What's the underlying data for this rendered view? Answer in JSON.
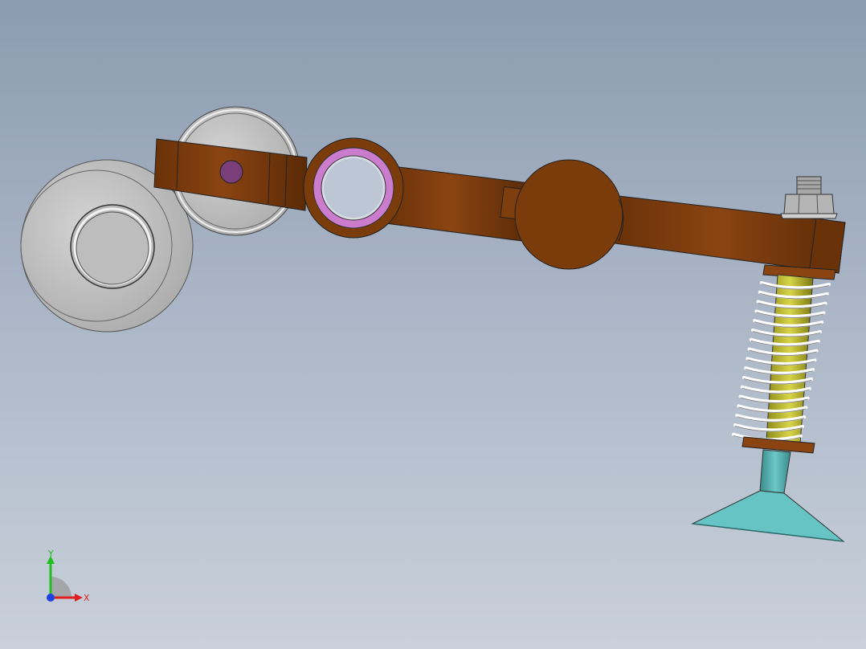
{
  "viewport": {
    "background_top": "#8c9bb0",
    "background_bottom": "#c9d0da"
  },
  "model": {
    "colors": {
      "arm": "#7a3c0a",
      "arm_dark": "#5e2d07",
      "arm_light": "#8a4a14",
      "bearing_ring": "#cc7ccc",
      "pin": "#7a3f7a",
      "roller": "#c8c8c8",
      "spring": "#ffffff",
      "spring_rod": "#c5c030",
      "suction_cup": "#66c4c4"
    }
  },
  "triad": {
    "x_label": "X",
    "y_label": "Y",
    "x_color": "#e02020",
    "y_color": "#20c020",
    "z_color": "#2040e0"
  }
}
